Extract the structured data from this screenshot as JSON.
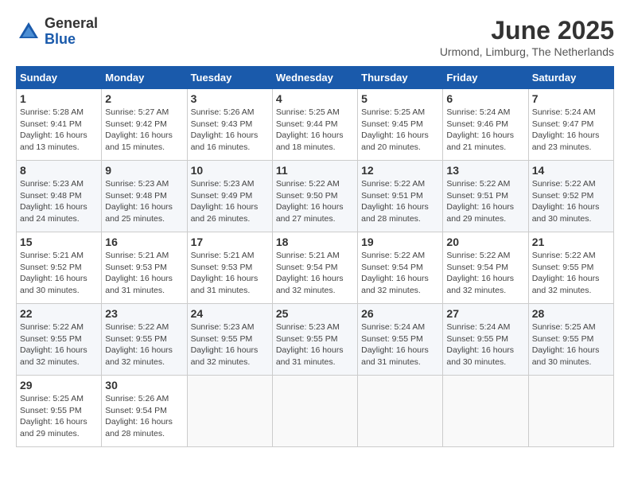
{
  "header": {
    "logo_general": "General",
    "logo_blue": "Blue",
    "month_title": "June 2025",
    "subtitle": "Urmond, Limburg, The Netherlands"
  },
  "calendar": {
    "days_of_week": [
      "Sunday",
      "Monday",
      "Tuesday",
      "Wednesday",
      "Thursday",
      "Friday",
      "Saturday"
    ],
    "weeks": [
      [
        null,
        {
          "day": 2,
          "sunrise": "5:27 AM",
          "sunset": "9:42 PM",
          "daylight": "16 hours and 15 minutes."
        },
        {
          "day": 3,
          "sunrise": "5:26 AM",
          "sunset": "9:43 PM",
          "daylight": "16 hours and 16 minutes."
        },
        {
          "day": 4,
          "sunrise": "5:25 AM",
          "sunset": "9:44 PM",
          "daylight": "16 hours and 18 minutes."
        },
        {
          "day": 5,
          "sunrise": "5:25 AM",
          "sunset": "9:45 PM",
          "daylight": "16 hours and 20 minutes."
        },
        {
          "day": 6,
          "sunrise": "5:24 AM",
          "sunset": "9:46 PM",
          "daylight": "16 hours and 21 minutes."
        },
        {
          "day": 7,
          "sunrise": "5:24 AM",
          "sunset": "9:47 PM",
          "daylight": "16 hours and 23 minutes."
        }
      ],
      [
        {
          "day": 1,
          "sunrise": "5:28 AM",
          "sunset": "9:41 PM",
          "daylight": "16 hours and 13 minutes."
        },
        null,
        null,
        null,
        null,
        null,
        null
      ],
      [
        {
          "day": 8,
          "sunrise": "5:23 AM",
          "sunset": "9:48 PM",
          "daylight": "16 hours and 24 minutes."
        },
        {
          "day": 9,
          "sunrise": "5:23 AM",
          "sunset": "9:48 PM",
          "daylight": "16 hours and 25 minutes."
        },
        {
          "day": 10,
          "sunrise": "5:23 AM",
          "sunset": "9:49 PM",
          "daylight": "16 hours and 26 minutes."
        },
        {
          "day": 11,
          "sunrise": "5:22 AM",
          "sunset": "9:50 PM",
          "daylight": "16 hours and 27 minutes."
        },
        {
          "day": 12,
          "sunrise": "5:22 AM",
          "sunset": "9:51 PM",
          "daylight": "16 hours and 28 minutes."
        },
        {
          "day": 13,
          "sunrise": "5:22 AM",
          "sunset": "9:51 PM",
          "daylight": "16 hours and 29 minutes."
        },
        {
          "day": 14,
          "sunrise": "5:22 AM",
          "sunset": "9:52 PM",
          "daylight": "16 hours and 30 minutes."
        }
      ],
      [
        {
          "day": 15,
          "sunrise": "5:21 AM",
          "sunset": "9:52 PM",
          "daylight": "16 hours and 30 minutes."
        },
        {
          "day": 16,
          "sunrise": "5:21 AM",
          "sunset": "9:53 PM",
          "daylight": "16 hours and 31 minutes."
        },
        {
          "day": 17,
          "sunrise": "5:21 AM",
          "sunset": "9:53 PM",
          "daylight": "16 hours and 31 minutes."
        },
        {
          "day": 18,
          "sunrise": "5:21 AM",
          "sunset": "9:54 PM",
          "daylight": "16 hours and 32 minutes."
        },
        {
          "day": 19,
          "sunrise": "5:22 AM",
          "sunset": "9:54 PM",
          "daylight": "16 hours and 32 minutes."
        },
        {
          "day": 20,
          "sunrise": "5:22 AM",
          "sunset": "9:54 PM",
          "daylight": "16 hours and 32 minutes."
        },
        {
          "day": 21,
          "sunrise": "5:22 AM",
          "sunset": "9:55 PM",
          "daylight": "16 hours and 32 minutes."
        }
      ],
      [
        {
          "day": 22,
          "sunrise": "5:22 AM",
          "sunset": "9:55 PM",
          "daylight": "16 hours and 32 minutes."
        },
        {
          "day": 23,
          "sunrise": "5:22 AM",
          "sunset": "9:55 PM",
          "daylight": "16 hours and 32 minutes."
        },
        {
          "day": 24,
          "sunrise": "5:23 AM",
          "sunset": "9:55 PM",
          "daylight": "16 hours and 32 minutes."
        },
        {
          "day": 25,
          "sunrise": "5:23 AM",
          "sunset": "9:55 PM",
          "daylight": "16 hours and 31 minutes."
        },
        {
          "day": 26,
          "sunrise": "5:24 AM",
          "sunset": "9:55 PM",
          "daylight": "16 hours and 31 minutes."
        },
        {
          "day": 27,
          "sunrise": "5:24 AM",
          "sunset": "9:55 PM",
          "daylight": "16 hours and 30 minutes."
        },
        {
          "day": 28,
          "sunrise": "5:25 AM",
          "sunset": "9:55 PM",
          "daylight": "16 hours and 30 minutes."
        }
      ],
      [
        {
          "day": 29,
          "sunrise": "5:25 AM",
          "sunset": "9:55 PM",
          "daylight": "16 hours and 29 minutes."
        },
        {
          "day": 30,
          "sunrise": "5:26 AM",
          "sunset": "9:54 PM",
          "daylight": "16 hours and 28 minutes."
        },
        null,
        null,
        null,
        null,
        null
      ]
    ]
  }
}
